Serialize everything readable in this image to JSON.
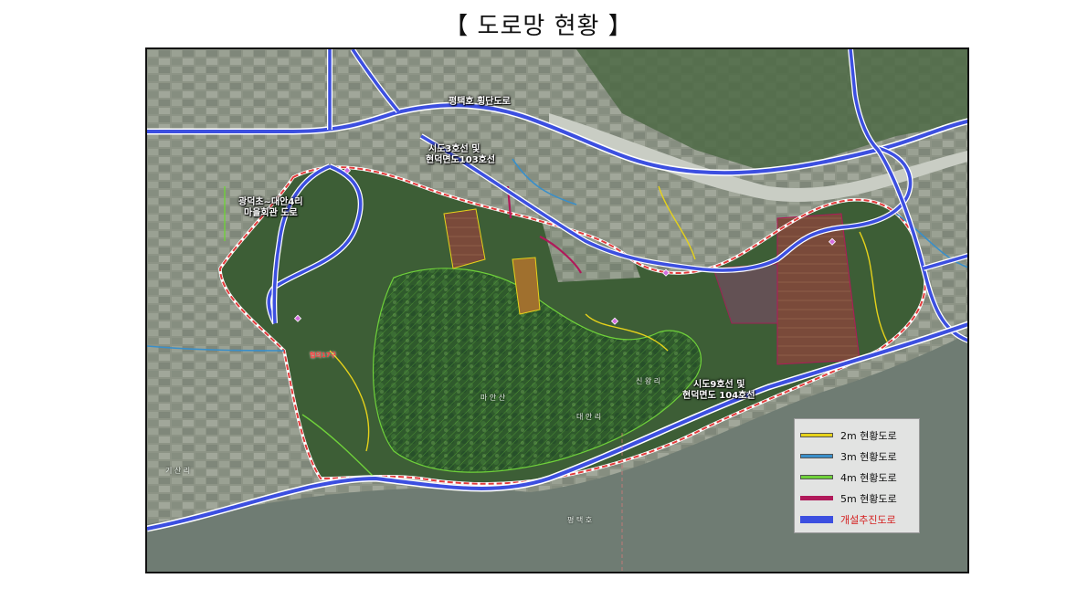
{
  "title": "【 도로망 현황 】",
  "map": {
    "road_labels": {
      "pyeongtaek_crossing": "평택호 횡단도로",
      "sido3_line1": "시도3호선 및",
      "sido3_line2": "현덕면도103호선",
      "gwangdeok_line1": "광덕초~대안4리",
      "gwangdeok_line2": "마을회관 도로",
      "sido9_line1": "시도9호선 및",
      "sido9_line2": "현덕면도 104호선"
    },
    "place_labels": {
      "maansan": "마 안 산",
      "daean_ri": "대 안 리",
      "sinwang_ri": "신 왕 리",
      "gisan_ri": "기 산 리",
      "pyeongtaek_ho": "평 택 호"
    },
    "red_label": "협의17구",
    "colors": {
      "road_2m": "#e6d21a",
      "road_3m": "#3a8fc9",
      "road_4m": "#6fd13a",
      "road_5m": "#b0195a",
      "planned": "#3c4fe0",
      "boundary": "#e23b3b"
    }
  },
  "legend": {
    "items": [
      {
        "label": "2m  현황도로"
      },
      {
        "label": "3m  현황도로"
      },
      {
        "label": "4m  현황도로"
      },
      {
        "label": "5m  현황도로"
      },
      {
        "label": "개설추진도로"
      }
    ]
  }
}
